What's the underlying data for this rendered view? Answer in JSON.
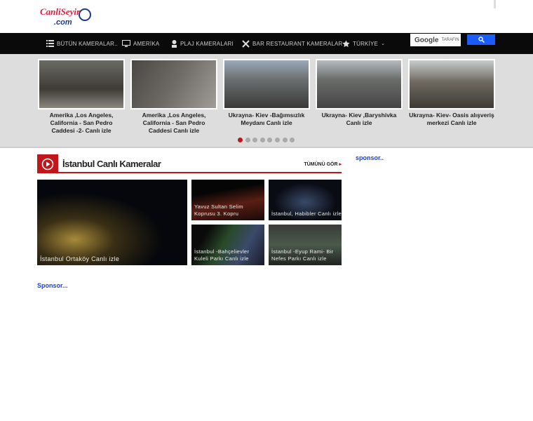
{
  "logo": {
    "text": "CanliSeyir",
    "sub": ".com"
  },
  "nav": {
    "items": [
      {
        "label": "BÜTÜN KAMERALAR..",
        "icon": "list-icon"
      },
      {
        "label": "AMERİKA",
        "icon": "monitor-icon"
      },
      {
        "label": "PLAJ KAMERALARI",
        "icon": "person-icon"
      },
      {
        "label": "BAR RESTAURANT KAMERALAR",
        "icon": "utensils-icon"
      },
      {
        "label": "TÜRKİYE",
        "icon": "star-icon"
      }
    ]
  },
  "search": {
    "brand": "Google",
    "suffix": "TARAFIN"
  },
  "slider": {
    "slides": [
      {
        "caption": "Amerika ,Los Angeles, California - San Pedro Caddesi -2- Canlı izle"
      },
      {
        "caption": "Amerika ,Los Angeles, California - San Pedro Caddesi Canlı izle"
      },
      {
        "caption": "Ukrayna- Kiev -Bağımsızlık Meydanı Canlı izle"
      },
      {
        "caption": "Ukrayna- Kiev ,Baryshivka Canlı izle"
      },
      {
        "caption": "Ukrayna- Kiev- Oasis alışveriş merkezi Canlı izle"
      }
    ],
    "dots": 8,
    "active_dot": 1,
    "accent": "#c0171d"
  },
  "section": {
    "title": "İstanbul Canlı Kameralar",
    "see_all": "TÜMÜNÜ GÖR",
    "featured": {
      "caption": "İstanbul Ortaköy Canlı izle"
    },
    "tiles": [
      {
        "caption": "Yavuz Sultan Selim Koprusu 3. Kopru"
      },
      {
        "caption": "İstanbul, Habibler Canlı izle"
      },
      {
        "caption": "İstanbul -Bahçelievler Kuleli Parkı Canlı izle"
      },
      {
        "caption": "İstanbul -Eyup Rami- Bir Nefes Parkı Canlı izle"
      }
    ]
  },
  "sponsor_right": "sponsor..",
  "sponsor_left": "Sponsor..."
}
